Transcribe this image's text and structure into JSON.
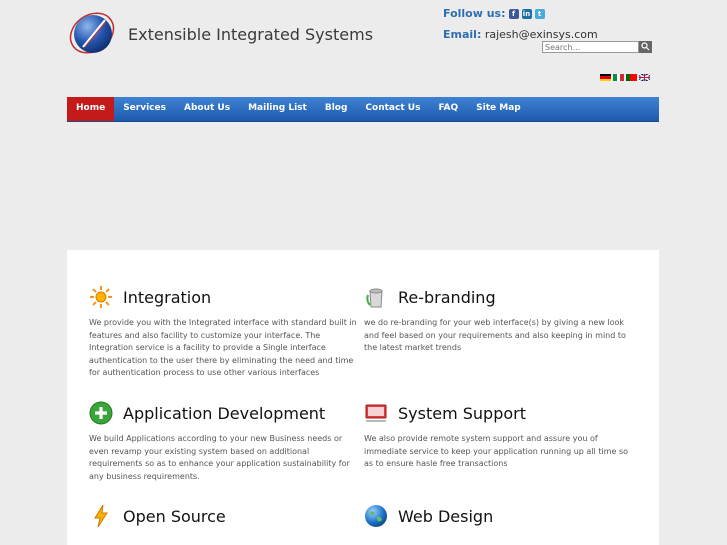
{
  "header": {
    "site_title": "Extensible Integrated Systems",
    "follow_label": "Follow us:",
    "social_icons": [
      "facebook-icon",
      "linkedin-icon",
      "twitter-icon"
    ],
    "email_label": "Email:",
    "email_value": "rajesh@exinsys.com",
    "search_placeholder": "Search..."
  },
  "languages": [
    "German",
    "Italian",
    "Portuguese",
    "English"
  ],
  "nav": {
    "items": [
      "Home",
      "Services",
      "About Us",
      "Mailing List",
      "Blog",
      "Contact Us",
      "FAQ",
      "Site Map"
    ],
    "active": "Home",
    "bar_color": "#2b6fc2",
    "active_color": "#c41a1a"
  },
  "services": [
    {
      "title": "Integration",
      "icon": "sun-icon",
      "desc": "We provide you with the Integrated interface with standard built in features and also facility to customize your interface. The Integration service is a facility to provide a Single interface authentication to the user there by eliminating the need and time for authentication process to use other various interfaces"
    },
    {
      "title": "Re-branding",
      "icon": "paint-bucket-icon",
      "desc": "we do re-branding for your web interface(s) by giving a new look and feel based on your requirements and also keeping in mind to the latest market trends"
    },
    {
      "title": "Application Development",
      "icon": "plus-icon",
      "desc": "We build Applications according to your new Business needs or even revamp your existing system based on additional requirements so as to enhance your application sustainability for any business requirements."
    },
    {
      "title": "System Support",
      "icon": "monitor-icon",
      "desc": "We also provide remote system support and assure you of immediate service to keep your application running up all time so as to ensure hasle free transactions"
    },
    {
      "title": "Open Source",
      "icon": "lightning-icon",
      "desc": ""
    },
    {
      "title": "Web Design",
      "icon": "globe-icon",
      "desc": ""
    }
  ]
}
